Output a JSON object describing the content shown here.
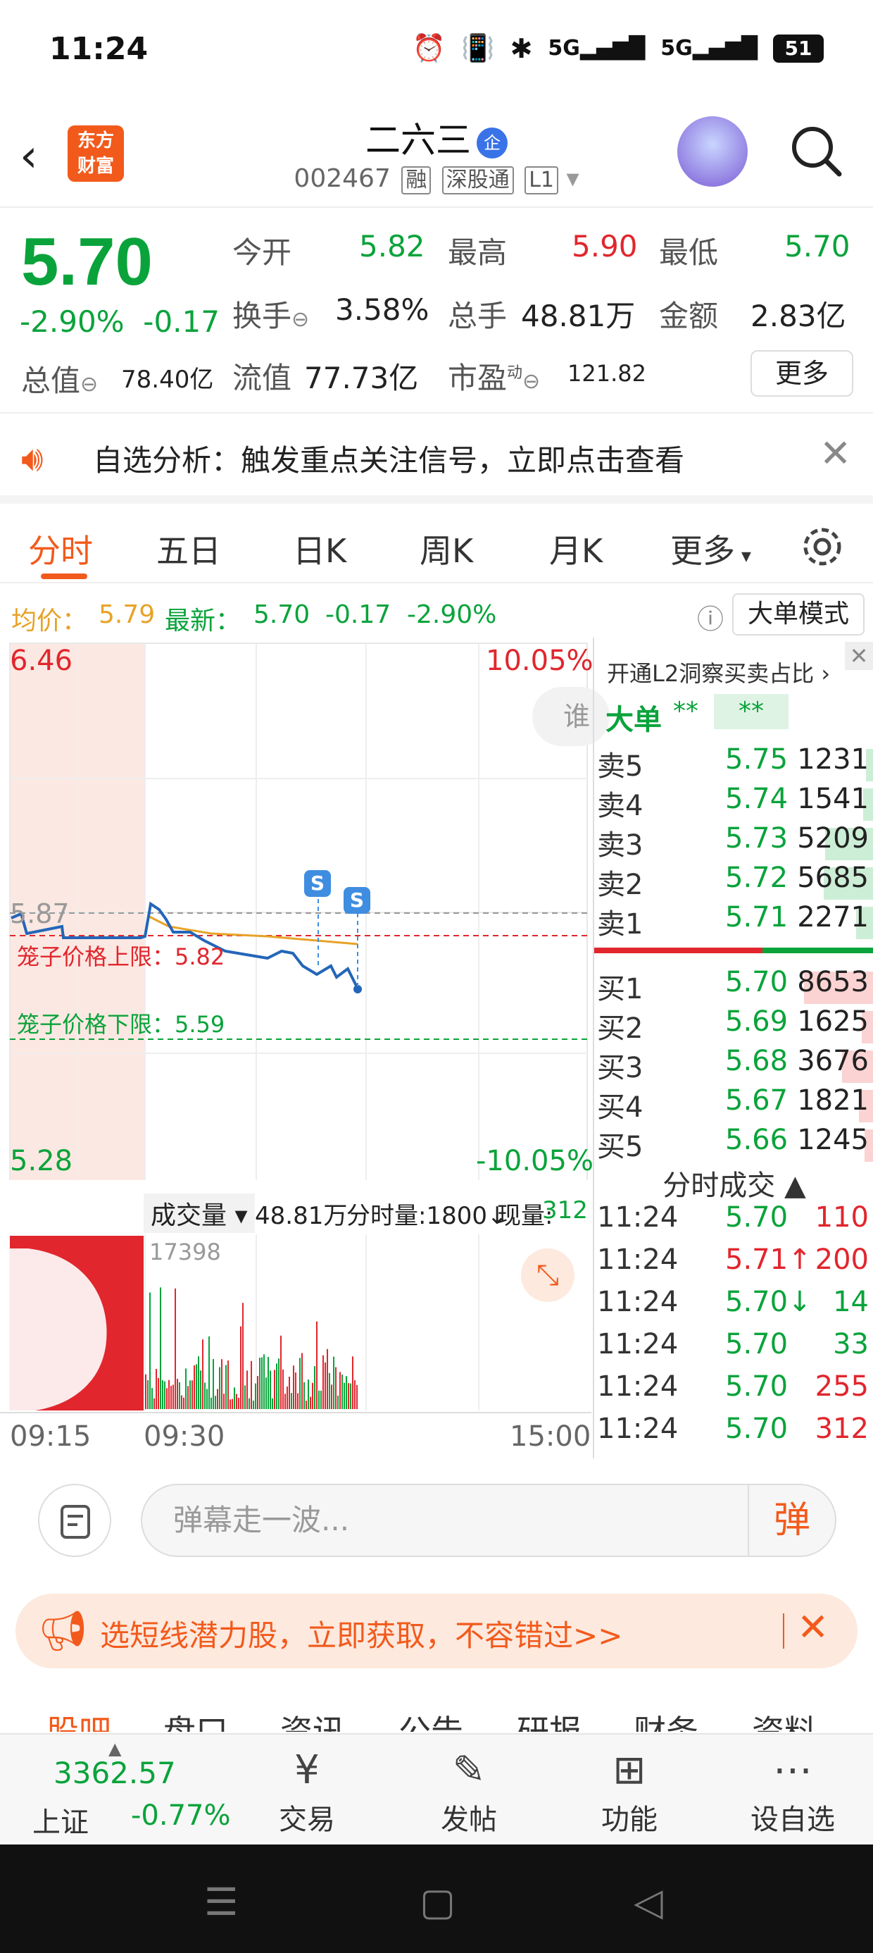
{
  "status": {
    "time": "11:24",
    "battery": "51",
    "net1": "5G",
    "net2": "5G"
  },
  "header": {
    "name": "二六三",
    "qi": "企",
    "code": "002467",
    "tags": [
      "融",
      "深股通",
      "L1"
    ],
    "logo": "东方\n财富"
  },
  "quote": {
    "price": "5.70",
    "chg_pct": "-2.90%",
    "chg": "-0.17",
    "open_lbl": "今开",
    "open": "5.82",
    "high_lbl": "最高",
    "high": "5.90",
    "low_lbl": "最低",
    "low": "5.70",
    "turn_lbl": "换手",
    "turn": "3.58%",
    "vol_lbl": "总手",
    "vol": "48.81万",
    "amt_lbl": "金额",
    "amt": "2.83亿",
    "mcap_lbl": "总值",
    "mcap": "78.40亿",
    "fmcap_lbl": "流值",
    "fmcap": "77.73亿",
    "pe_lbl": "市盈",
    "pe_sup": "动",
    "pe": "121.82",
    "more": "更多"
  },
  "alert": {
    "text": "自选分析：触发重点关注信号，立即点击查看"
  },
  "tabs": [
    "分时",
    "五日",
    "日K",
    "周K",
    "月K",
    "更多"
  ],
  "avg": {
    "avg_lbl": "均价：",
    "avg": "5.79",
    "last_lbl": "最新：",
    "last": "5.70",
    "chg": "-0.17",
    "pct": "-2.90%",
    "bigmode": "大单模式"
  },
  "chart": {
    "top_price": "6.46",
    "top_pct": "10.05%",
    "bot_price": "5.28",
    "bot_pct": "-10.05%",
    "ref": "5.87",
    "upper_lbl": "笼子价格上限：5.82",
    "lower_lbl": "笼子价格下限：5.59",
    "vol_lbl": "成交量",
    "vol_total": "48.81万",
    "vol_min": "分时量:1800↓",
    "vol_now_lbl": "现量:",
    "vol_now": "312",
    "vol_max": "17398",
    "t0": "09:15",
    "t1": "09:30",
    "t2": "15:00",
    "who": "谁",
    "s": "S"
  },
  "book": {
    "title": "开通L2洞察买卖占比 ›",
    "big_lbl": "大单",
    "big1": "**",
    "big2": "**",
    "asks": [
      {
        "lbl": "卖5",
        "price": "5.75",
        "vol": "1231"
      },
      {
        "lbl": "卖4",
        "price": "5.74",
        "vol": "1541"
      },
      {
        "lbl": "卖3",
        "price": "5.73",
        "vol": "5209"
      },
      {
        "lbl": "卖2",
        "price": "5.72",
        "vol": "5685"
      },
      {
        "lbl": "卖1",
        "price": "5.71",
        "vol": "2271"
      }
    ],
    "bids": [
      {
        "lbl": "买1",
        "price": "5.70",
        "vol": "8653"
      },
      {
        "lbl": "买2",
        "price": "5.69",
        "vol": "1625"
      },
      {
        "lbl": "买3",
        "price": "5.68",
        "vol": "3676"
      },
      {
        "lbl": "买4",
        "price": "5.67",
        "vol": "1821"
      },
      {
        "lbl": "买5",
        "price": "5.66",
        "vol": "1245"
      }
    ],
    "ticks_title": "分时成交 ▲",
    "ticks": [
      {
        "t": "11:24",
        "p": "5.70",
        "v": "110"
      },
      {
        "t": "11:24",
        "p": "5.71↑",
        "v": "200"
      },
      {
        "t": "11:24",
        "p": "5.70↓",
        "v": "14"
      },
      {
        "t": "11:24",
        "p": "5.70",
        "v": "33"
      },
      {
        "t": "11:24",
        "p": "5.70",
        "v": "255"
      },
      {
        "t": "11:24",
        "p": "5.70",
        "v": "312"
      }
    ]
  },
  "comment": {
    "placeholder": "弹幕走一波...",
    "send": "弹"
  },
  "promo": {
    "text": "选短线潜力股，立即获取，不容错过>>"
  },
  "subtabs": [
    "股吧",
    "盘口",
    "资讯",
    "公告",
    "研报",
    "财务",
    "资料"
  ],
  "bottom": {
    "index_val": "3362.57",
    "index_name": "上证",
    "index_chg": "-0.77%",
    "items": [
      "交易",
      "发帖",
      "功能",
      "设自选"
    ]
  }
}
